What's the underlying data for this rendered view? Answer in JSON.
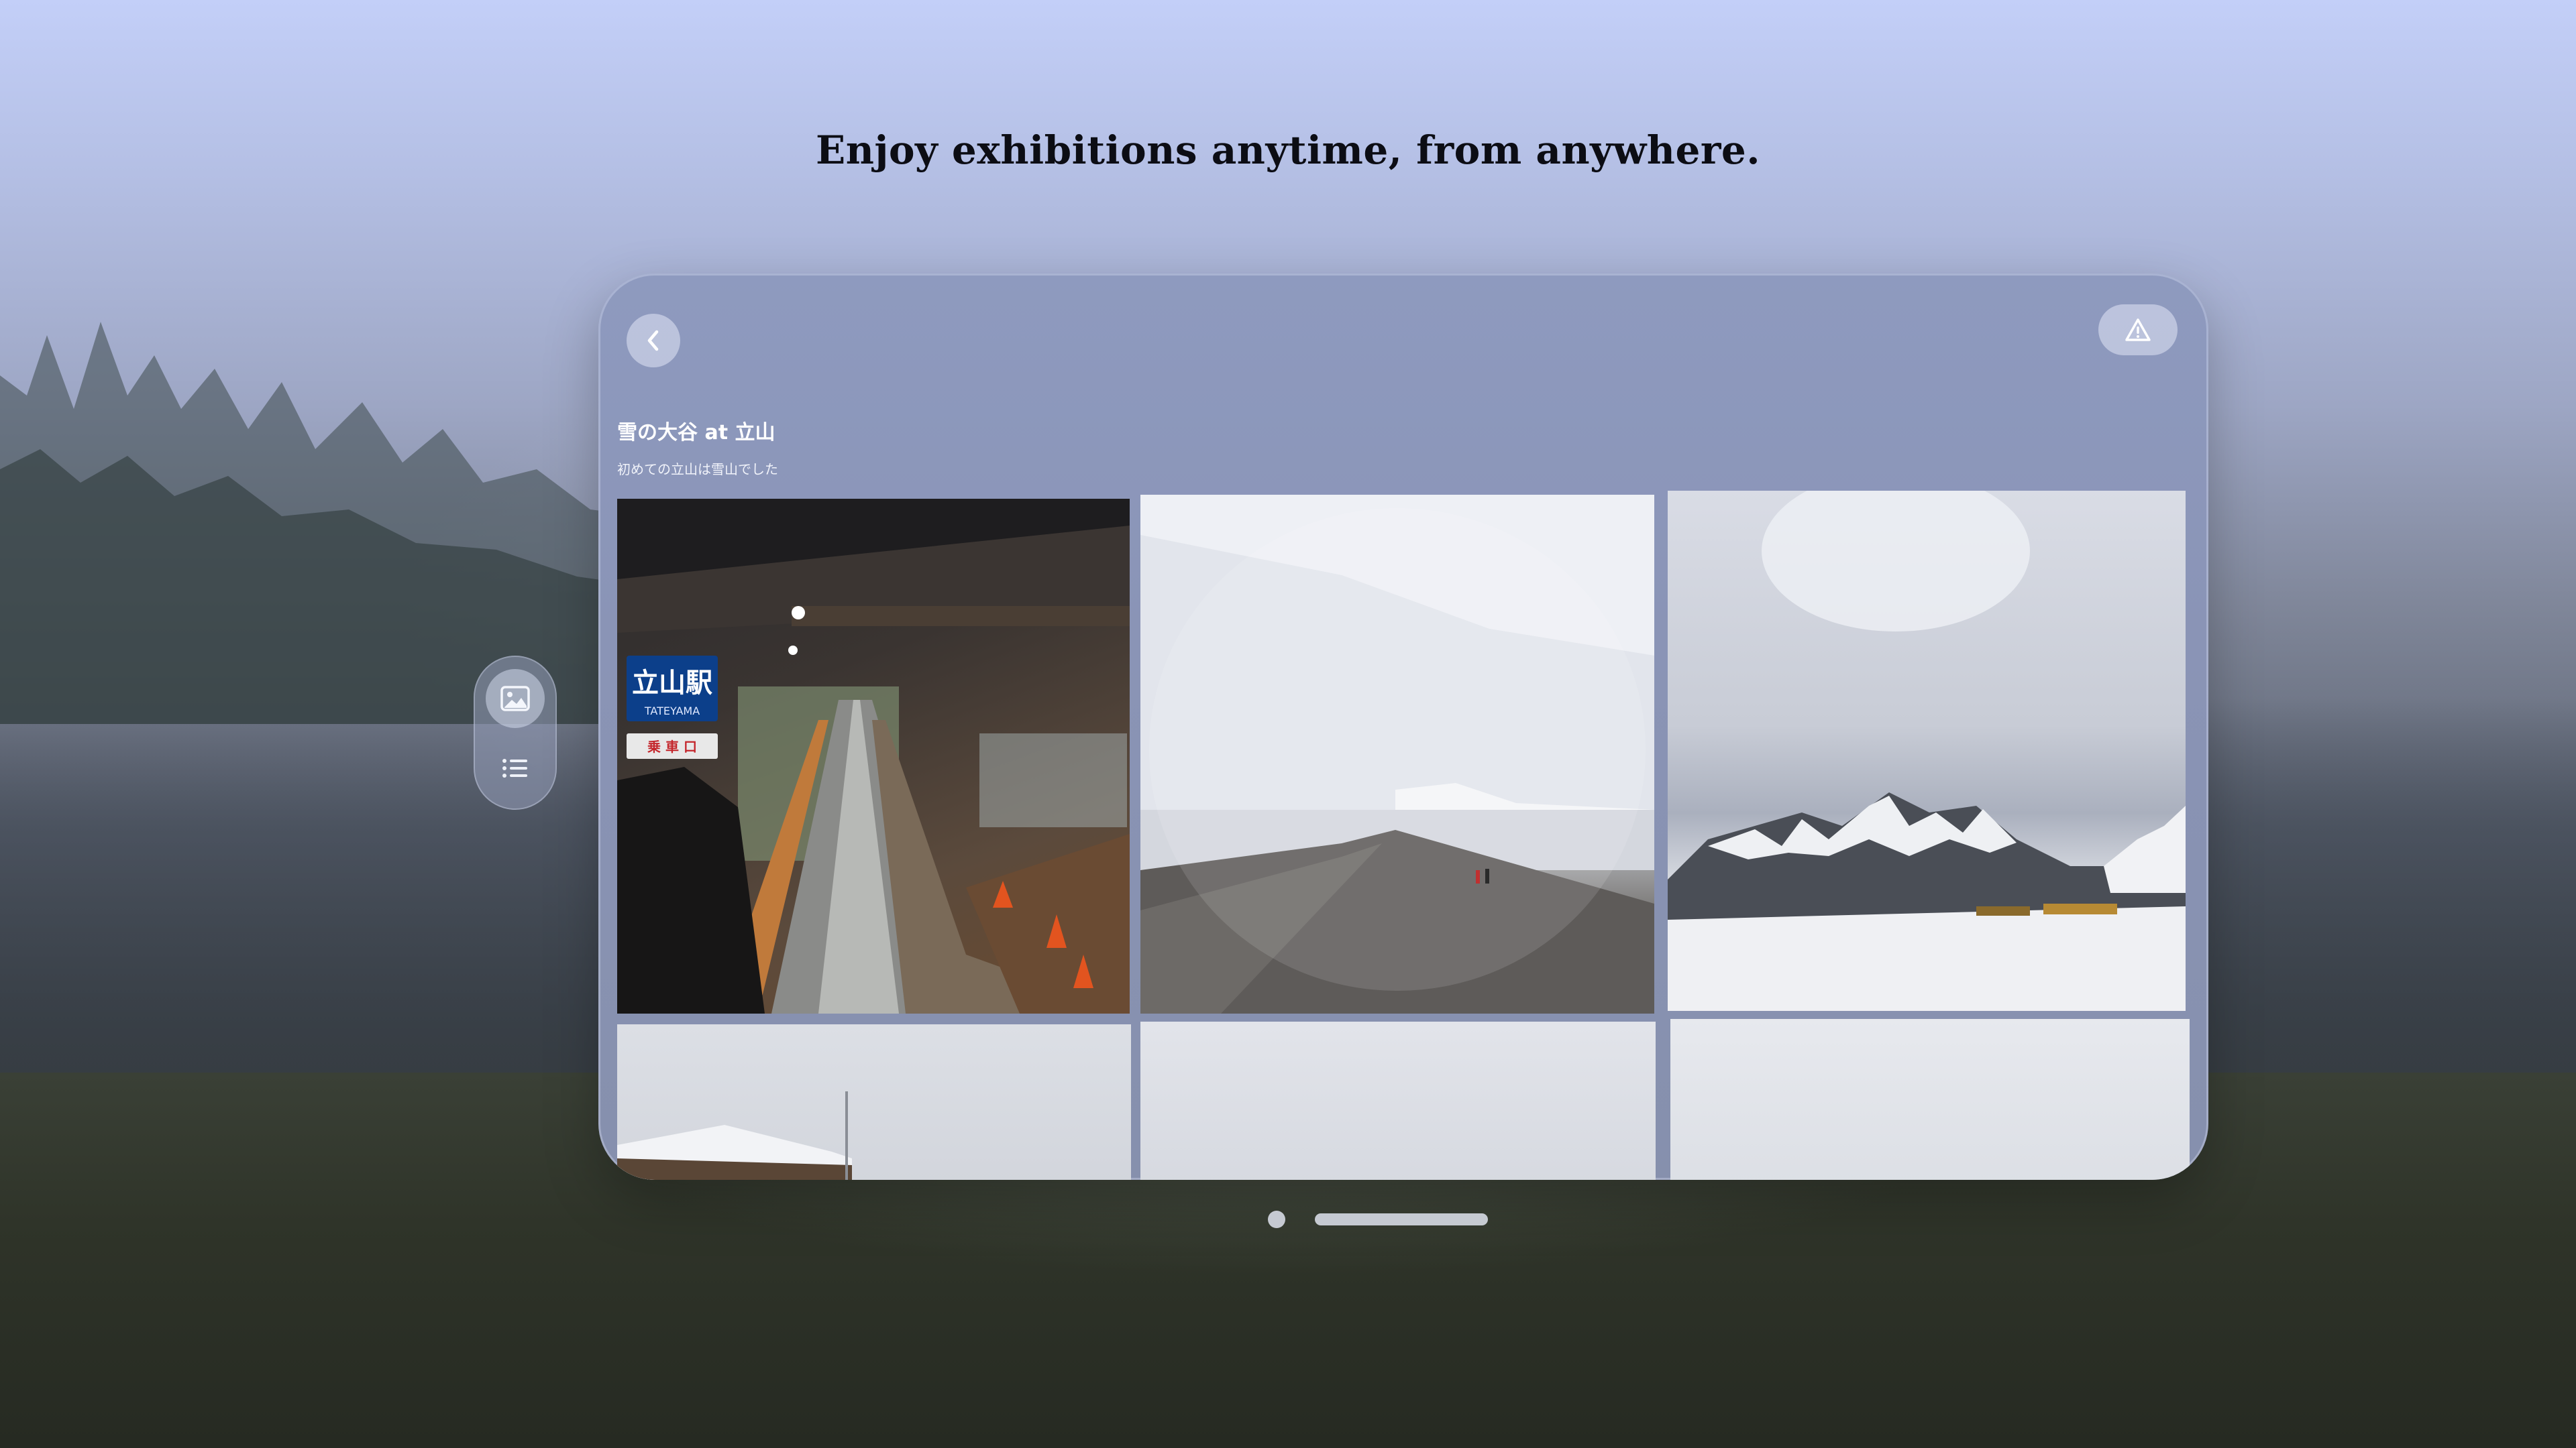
{
  "tagline": "Enjoy exhibitions anytime, from anywhere.",
  "window": {
    "album_title": "雪の大谷 at 立山",
    "album_subtitle": "初めての立山は雪山でした",
    "back_icon": "chevron-left-icon",
    "report_icon": "warning-triangle-icon"
  },
  "photos": [
    {
      "id": "photo-1",
      "sign_main": "立山駅",
      "sign_sub": "TATEYAMA",
      "sign_gate": "乗 車 口"
    },
    {
      "id": "photo-2"
    },
    {
      "id": "photo-3"
    },
    {
      "id": "photo-4"
    },
    {
      "id": "photo-5"
    },
    {
      "id": "photo-6"
    }
  ],
  "ornament": {
    "items": [
      {
        "icon": "photo-icon",
        "selected": true
      },
      {
        "icon": "list-icon",
        "selected": false
      }
    ]
  },
  "colors": {
    "window_glass": "#8a94b6",
    "control_fill": "#e1e6f5",
    "text_light": "#ffffff",
    "tagline": "#0c0d14"
  }
}
